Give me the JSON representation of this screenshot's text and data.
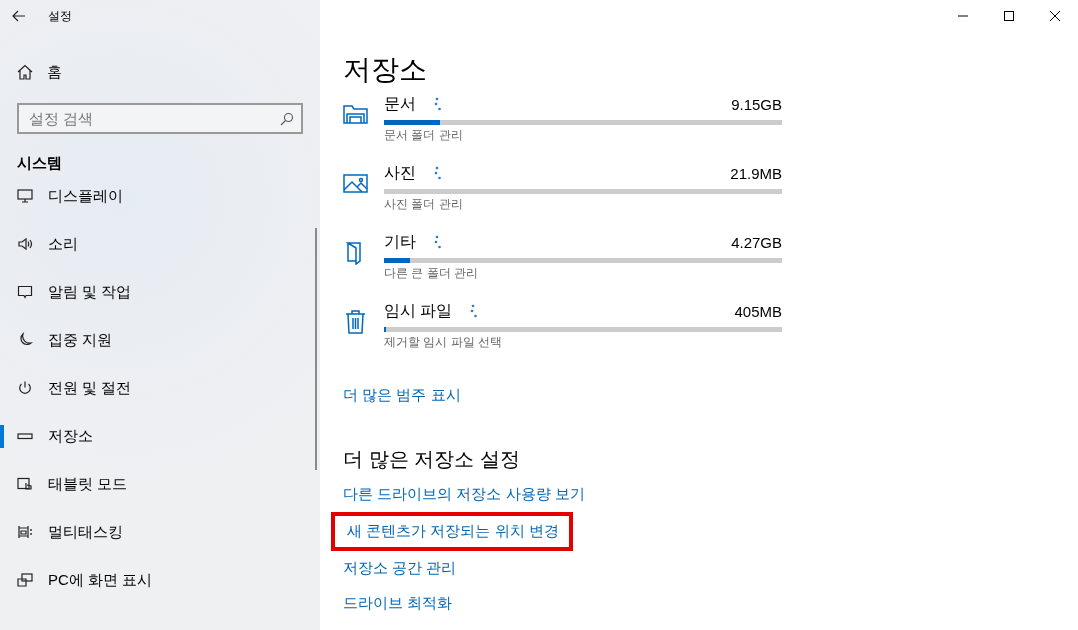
{
  "window": {
    "title": "설정"
  },
  "sidebar": {
    "home": "홈",
    "search": {
      "placeholder": "설정 검색"
    },
    "section": "시스템",
    "items": [
      {
        "label": "디스플레이",
        "selected": false
      },
      {
        "label": "소리",
        "selected": false
      },
      {
        "label": "알림 및 작업",
        "selected": false
      },
      {
        "label": "집중 지원",
        "selected": false
      },
      {
        "label": "전원 및 절전",
        "selected": false
      },
      {
        "label": "저장소",
        "selected": true
      },
      {
        "label": "태블릿 모드",
        "selected": false
      },
      {
        "label": "멀티태스킹",
        "selected": false
      },
      {
        "label": "PC에 화면 표시",
        "selected": false
      }
    ]
  },
  "content": {
    "title": "저장소",
    "categories": [
      {
        "name": "문서",
        "size": "9.15GB",
        "level": 0.14,
        "action": "문서 폴더 관리"
      },
      {
        "name": "사진",
        "size": "21.9MB",
        "level": 0,
        "action": "사진 폴더 관리"
      },
      {
        "name": "기타",
        "size": "4.27GB",
        "level": 0.065,
        "action": "다른 큰 폴더 관리"
      },
      {
        "name": "임시 파일",
        "size": "405MB",
        "level": 0.006,
        "action": "제거할 임시 파일 선택"
      }
    ],
    "more_link": "더 많은 범주 표시",
    "settings": {
      "heading": "더 많은 저장소 설정",
      "links": [
        {
          "label": "다른 드라이브의 저장소 사용량 보기",
          "highlighted": false
        },
        {
          "label": "새 콘텐츠가 저장되는 위치 변경",
          "highlighted": true
        },
        {
          "label": "저장소 공간 관리",
          "highlighted": false
        },
        {
          "label": "드라이브 최적화",
          "highlighted": false
        }
      ]
    }
  }
}
